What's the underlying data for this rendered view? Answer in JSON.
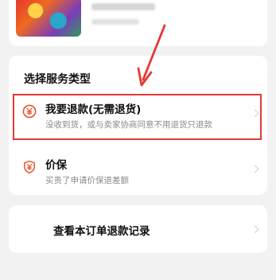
{
  "section": {
    "title": "选择服务类型"
  },
  "options": [
    {
      "title": "我要退款(无需退货)",
      "subtitle": "没收到货，或与卖家协商同意不用退货只退款",
      "icon": "refund-coin-icon",
      "highlighted": true
    },
    {
      "title": "价保",
      "subtitle": "买贵了申请价保退差额",
      "icon": "price-protect-shield-icon",
      "highlighted": false
    }
  ],
  "record": {
    "label": "查看本订单退款记录"
  },
  "colors": {
    "accent": "#e8562a",
    "highlight_border": "#e53935",
    "background": "#f2f2f2"
  }
}
